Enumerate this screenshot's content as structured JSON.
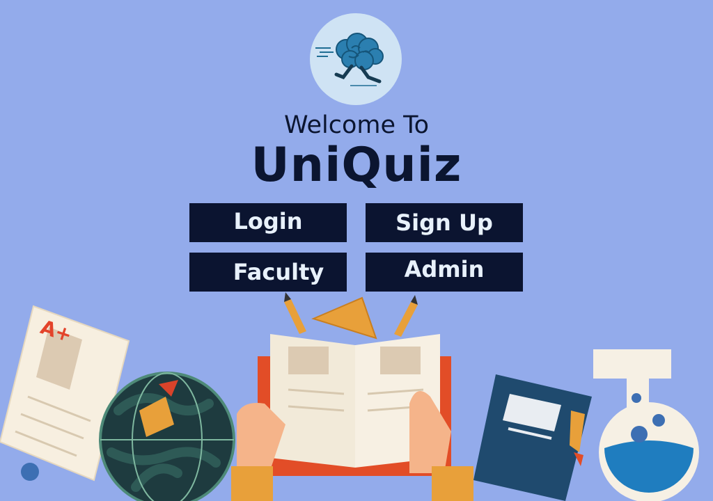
{
  "header": {
    "welcome_text": "Welcome To",
    "app_title": "UniQuiz",
    "logo_icon": "running-brain-icon"
  },
  "buttons": {
    "login": "Login",
    "signup": "Sign Up",
    "faculty": "Faculty",
    "admin": "Admin"
  },
  "illustration": {
    "grade_mark": "A+",
    "items": [
      "grade-paper-icon",
      "globe-icon",
      "open-book-icon",
      "pencil-icon",
      "triangle-ruler-icon",
      "notebook-icon",
      "flask-icon"
    ]
  },
  "colors": {
    "background": "#93abeb",
    "button_bg": "#0b1430",
    "button_text": "#e8f1fb",
    "title_text": "#0b1530"
  }
}
